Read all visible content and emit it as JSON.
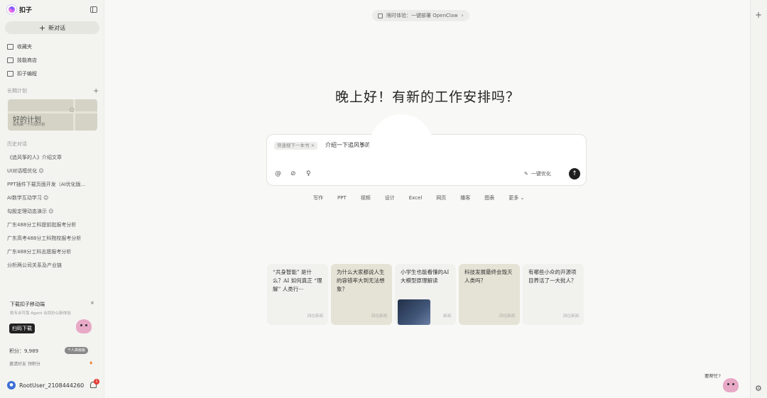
{
  "app": {
    "name": "扣子"
  },
  "sidebar": {
    "new_chat_label": "新对话",
    "nav": [
      {
        "label": "收藏夹",
        "icon": "folder-icon"
      },
      {
        "label": "技能商店",
        "icon": "books-icon"
      },
      {
        "label": "扣子编程",
        "icon": "code-file-icon"
      }
    ],
    "plans_label": "长期计划",
    "plan_card": {
      "title": "好的计划",
      "subtitle": "会先做一个行动计划"
    },
    "history_label": "历史对话",
    "history": [
      "《追风筝的人》介绍文章",
      "UI对话框优化 ☺",
      "PPT插件下载页面开发（AI优化版...",
      "AI数学互动学习 ☺",
      "勾股定理动态演示 ☺",
      "广东488分工科提前批报考分析",
      "广东高考488分工科院校报考分析",
      "广东488分工科志愿报考分析",
      "分析两公司关系及产业链"
    ],
    "download": {
      "title": "下载扣子移动端",
      "subtitle": "和专业可靠 Agent 合同办公新体验",
      "button": "扫码下载",
      "close": "×"
    },
    "points_label": "积分：9,989",
    "member_badge": "个人高级版",
    "invite_label": "邀请好友 领积分",
    "user_name": "RootUser_2108444260",
    "notification_count": "1"
  },
  "main": {
    "banner": "限时体验：一键部署 OpenClaw",
    "greeting": "晚上好！有新的工作安排吗？",
    "input": {
      "chip": "快速搜下一本书 ×",
      "text": "介绍一下追风筝的人这本书",
      "optimize_label": "一键优化"
    },
    "modes": [
      "写作",
      "PPT",
      "视频",
      "设计",
      "Excel",
      "网页",
      "播客",
      "图表",
      "更多 ⌄"
    ],
    "cards": [
      {
        "text": "“共身智能” 是什么？AI 如何真正 “理解” 人类行···",
        "tag": "四位新闻"
      },
      {
        "text": "为什么大家都说人生的容错率大到无法想象？",
        "tag": "四位新闻"
      },
      {
        "text": "小学生也能看懂的AI大模型原理解读",
        "tag": "新闻"
      },
      {
        "text": "科技发展最终会毁灭人类吗？",
        "tag": "四位新闻"
      },
      {
        "text": "有哪些小众的开源项目养活了一大批人？",
        "tag": "四位新闻"
      }
    ],
    "help_label": "要帮忙?"
  }
}
